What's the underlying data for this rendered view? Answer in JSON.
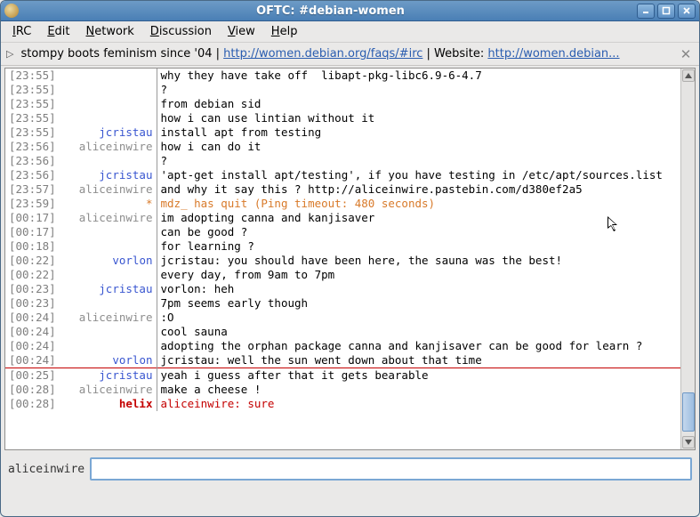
{
  "window": {
    "title": "OFTC: #debian-women"
  },
  "menu": {
    "irc": "IRC",
    "edit": "Edit",
    "network": "Network",
    "discussion": "Discussion",
    "view": "View",
    "help": "Help"
  },
  "topic": {
    "prefix": "stompy boots feminism since '04 | ",
    "link1": "http://women.debian.org/faqs/#irc",
    "mid": " | Website: ",
    "link2": "http://women.debian..."
  },
  "own_nick": "aliceinwire",
  "input_value": "",
  "lines": [
    {
      "ts": "[23:55]",
      "nick": "",
      "cls": "",
      "msg": "why they have take off  libapt-pkg-libc6.9-6-4.7"
    },
    {
      "ts": "[23:55]",
      "nick": "",
      "cls": "",
      "msg": "?"
    },
    {
      "ts": "[23:55]",
      "nick": "",
      "cls": "",
      "msg": "from debian sid"
    },
    {
      "ts": "[23:55]",
      "nick": "",
      "cls": "",
      "msg": "how i can use lintian without it"
    },
    {
      "ts": "[23:55]",
      "nick": "jcristau",
      "cls": "nick-jcristau",
      "msg": "install apt from testing"
    },
    {
      "ts": "[23:56]",
      "nick": "aliceinwire",
      "cls": "nick-aliceinwire",
      "msg": "how i can do it"
    },
    {
      "ts": "[23:56]",
      "nick": "",
      "cls": "",
      "msg": "?"
    },
    {
      "ts": "[23:56]",
      "nick": "jcristau",
      "cls": "nick-jcristau",
      "msg": "'apt-get install apt/testing', if you have testing in /etc/apt/sources.list"
    },
    {
      "ts": "[23:57]",
      "nick": "aliceinwire",
      "cls": "nick-aliceinwire",
      "msg": "and why it say this ? http://aliceinwire.pastebin.com/d380ef2a5"
    },
    {
      "ts": "[23:59]",
      "nick": "*",
      "cls": "nick-star",
      "msg": "mdz_ has quit (Ping timeout: 480 seconds)",
      "mcls": "msg-quit"
    },
    {
      "ts": "[00:17]",
      "nick": "aliceinwire",
      "cls": "nick-aliceinwire",
      "msg": "im adopting canna and kanjisaver"
    },
    {
      "ts": "[00:17]",
      "nick": "",
      "cls": "",
      "msg": "can be good ?"
    },
    {
      "ts": "[00:18]",
      "nick": "",
      "cls": "",
      "msg": "for learning ?"
    },
    {
      "ts": "[00:22]",
      "nick": "vorlon",
      "cls": "nick-vorlon",
      "msg": "jcristau: you should have been here, the sauna was the best!"
    },
    {
      "ts": "[00:22]",
      "nick": "",
      "cls": "",
      "msg": "every day, from 9am to 7pm"
    },
    {
      "ts": "[00:23]",
      "nick": "jcristau",
      "cls": "nick-jcristau",
      "msg": "vorlon: heh"
    },
    {
      "ts": "[00:23]",
      "nick": "",
      "cls": "",
      "msg": "7pm seems early though"
    },
    {
      "ts": "[00:24]",
      "nick": "aliceinwire",
      "cls": "nick-aliceinwire",
      "msg": ":O"
    },
    {
      "ts": "[00:24]",
      "nick": "",
      "cls": "",
      "msg": "cool sauna"
    },
    {
      "ts": "[00:24]",
      "nick": "",
      "cls": "",
      "msg": "adopting the orphan package canna and kanjisaver can be good for learn ?"
    },
    {
      "ts": "[00:24]",
      "nick": "vorlon",
      "cls": "nick-vorlon",
      "msg": "jcristau: well the sun went down about that time"
    },
    {
      "ts": "[00:25]",
      "nick": "jcristau",
      "cls": "nick-jcristau",
      "msg": "yeah i guess after that it gets bearable",
      "hr": true
    },
    {
      "ts": "[00:28]",
      "nick": "aliceinwire",
      "cls": "nick-aliceinwire",
      "msg": "make a cheese !"
    },
    {
      "ts": "[00:28]",
      "nick": "helix",
      "cls": "nick-helix",
      "msg": "aliceinwire: sure",
      "mcls": "msg-hl"
    }
  ]
}
